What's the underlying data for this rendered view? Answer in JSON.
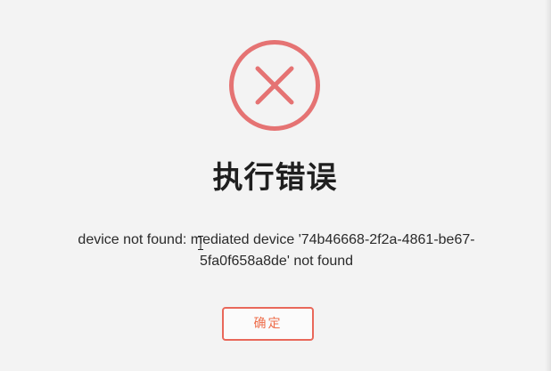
{
  "dialog": {
    "icon": "close-circle-icon",
    "title": "执行错误",
    "message": "device not found: mediated device '74b46668-2f2a-4861-be67-5fa0f658a8de' not found",
    "confirm_label": "确定"
  },
  "colors": {
    "error": "#e57373",
    "button_border": "#e9685a",
    "button_text": "#ee6e4b",
    "background": "#f3f3f3"
  }
}
